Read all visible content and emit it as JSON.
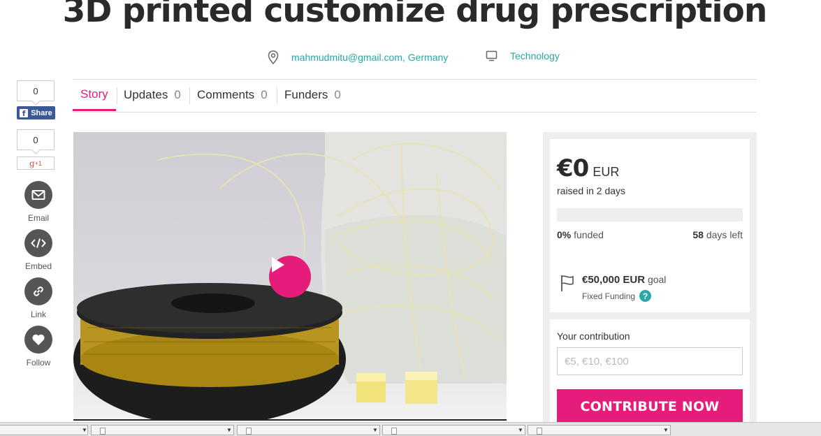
{
  "page": {
    "title": "3D printed customize drug prescription"
  },
  "meta": {
    "location": "mahmudmitu@gmail.com, Germany",
    "category": "Technology",
    "location_icon": "map-pin-icon",
    "category_icon": "monitor-icon"
  },
  "share": {
    "facebook_count": "0",
    "facebook_label": "Share",
    "gplus_count": "0",
    "gplus_label": "+1",
    "email_label": "Email",
    "embed_label": "Embed",
    "link_label": "Link",
    "follow_label": "Follow"
  },
  "tabs": [
    {
      "label": "Story",
      "count": ""
    },
    {
      "label": "Updates",
      "count": "0"
    },
    {
      "label": "Comments",
      "count": "0"
    },
    {
      "label": "Funders",
      "count": "0"
    }
  ],
  "campaign": {
    "raised_amount": "€0",
    "raised_currency": "EUR",
    "raised_period": "raised in 2 days",
    "progress_fraction": 0,
    "funded_percent": "0%",
    "funded_label": "funded",
    "days_left": "58",
    "days_left_label": "days left",
    "goal_amount": "€50,000 EUR",
    "goal_label": "goal",
    "funding_type": "Fixed Funding",
    "help_glyph": "?"
  },
  "contribution": {
    "label": "Your contribution",
    "placeholder": "€5, €10, €100",
    "button_label": "CONTRIBUTE NOW"
  },
  "colors": {
    "accent": "#e61c7b",
    "link": "#2aa7a6",
    "facebook": "#3b5998"
  }
}
